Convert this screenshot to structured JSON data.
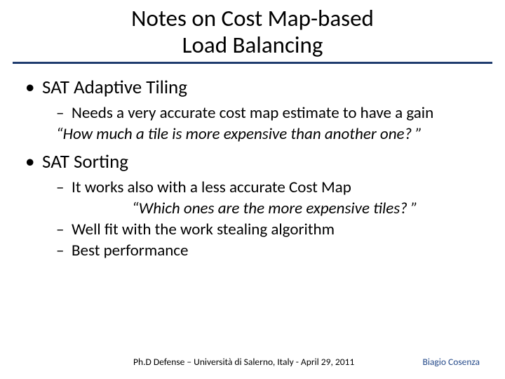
{
  "title_line1": "Notes on Cost Map-based",
  "title_line2": "Load Balancing",
  "section1": {
    "heading": "SAT Adaptive Tiling",
    "point1": "Needs a very accurate cost map estimate to have a gain",
    "quote": "“How much a tile is more expensive than another one? ”"
  },
  "section2": {
    "heading": "SAT Sorting",
    "point1": "It works also with a less accurate Cost Map",
    "quote": "“Which ones are the more expensive tiles? ”",
    "point2": "Well fit with the work stealing algorithm",
    "point3": "Best performance"
  },
  "footer": {
    "left": "Ph.D Defense – Università di Salerno, Italy - April 29, 2011",
    "right": "Biagio Cosenza"
  }
}
